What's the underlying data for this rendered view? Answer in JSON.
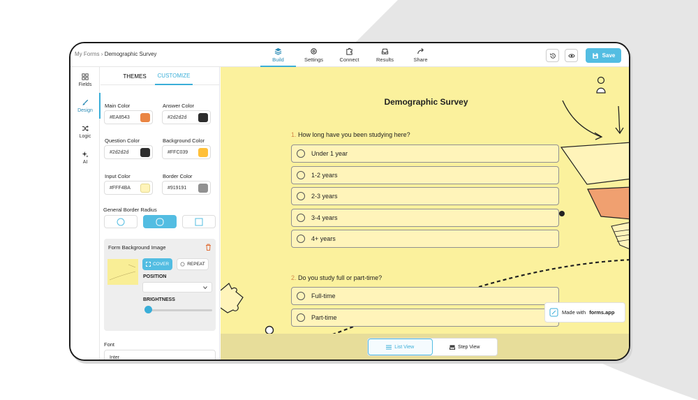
{
  "header": {
    "breadcrumb_root": "My Forms",
    "breadcrumb_sep": "›",
    "breadcrumb_current": "Demographic Survey",
    "tabs": [
      {
        "label": "Build",
        "icon": "layers-icon"
      },
      {
        "label": "Settings",
        "icon": "gear-icon"
      },
      {
        "label": "Connect",
        "icon": "puzzle-icon"
      },
      {
        "label": "Results",
        "icon": "inbox-icon"
      },
      {
        "label": "Share",
        "icon": "share-icon"
      }
    ],
    "save_label": "Save"
  },
  "rail": {
    "items": [
      {
        "label": "Fields",
        "icon": "grid-icon"
      },
      {
        "label": "Design",
        "icon": "brush-icon"
      },
      {
        "label": "Logic",
        "icon": "shuffle-icon"
      },
      {
        "label": "AI",
        "icon": "sparkle-icon"
      }
    ]
  },
  "design": {
    "tabs": [
      "THEMES",
      "CUSTOMIZE"
    ],
    "colors": [
      {
        "label": "Main Color",
        "value": "#EA8543",
        "swatch": "#EA8543"
      },
      {
        "label": "Answer Color",
        "value": "#2d2d2d",
        "swatch": "#2d2d2d"
      },
      {
        "label": "Question Color",
        "value": "#2d2d2d",
        "swatch": "#2d2d2d"
      },
      {
        "label": "Background Color",
        "value": "#FFC039",
        "swatch": "#FFC039"
      },
      {
        "label": "Input Color",
        "value": "#FFF4BA",
        "swatch": "#FFF4BA"
      },
      {
        "label": "Border Color",
        "value": "#919191",
        "swatch": "#919191"
      }
    ],
    "border_radius_label": "General Border Radius",
    "form_bg_label": "Form Background Image",
    "cover_label": "COVER",
    "repeat_label": "REPEAT",
    "position_label": "POSITION",
    "brightness_label": "BRIGHTNESS",
    "font_label": "Font",
    "font_value": "Inter"
  },
  "form": {
    "title": "Demographic Survey",
    "questions": [
      {
        "number": "1.",
        "text": "How long have you been studying here?",
        "options": [
          "Under 1 year",
          "1-2 years",
          "2-3 years",
          "3-4 years",
          "4+ years"
        ]
      },
      {
        "number": "2.",
        "text": "Do you study full or part-time?",
        "options": [
          "Full-time",
          "Part-time"
        ]
      }
    ],
    "view_toggle": [
      "List View",
      "Step View"
    ],
    "made_with_prefix": "Made with",
    "made_with_brand": "forms.app"
  },
  "theme": {
    "accent": "#53bde2",
    "preview_bg": "#fbf19d",
    "input_bg": "#fff4ba",
    "border": "#919191"
  }
}
